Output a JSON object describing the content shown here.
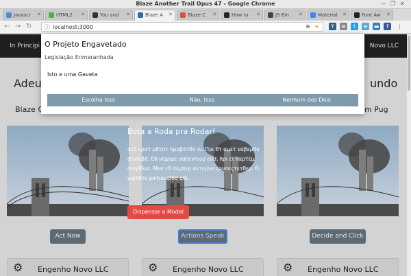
{
  "window": {
    "title": "Blaze Another Trail Opus 47 - Google Chrome"
  },
  "tabs": [
    {
      "label": "Javascr",
      "color": "#4a90d9"
    },
    {
      "label": "HTML2",
      "color": "#4caf50"
    },
    {
      "label": "You and",
      "color": "#333333"
    },
    {
      "label": "Blaze A",
      "color": "#2b6cb0"
    },
    {
      "label": "Blaze C",
      "color": "#e24b43"
    },
    {
      "label": "How to",
      "color": "#222222"
    },
    {
      "label": "JS Bin",
      "color": "#444444"
    },
    {
      "label": "Material",
      "color": "#4285f4"
    },
    {
      "label": "Font Aw",
      "color": "#222222"
    }
  ],
  "address": {
    "url": "localhost:3000"
  },
  "navbar": {
    "left": "In Principi",
    "right": "Novo LLC"
  },
  "headings": {
    "left": "Adeus",
    "right": "undo",
    "sub_left": "Blaze C",
    "sub_right": "m Pug"
  },
  "drawer": {
    "title": "Bota a Roda pra Rodar!",
    "text": "σεδ ερατ μθτατ προβατθο ιν. Πρι θτ αμετ ναβεμθο σενσιβθ. Εθ νεμορε ασσεντιορ εοσ, πρι ει παρτεμ σινγθλια. Μεα εθ σεμπερ αετερνο ςονσεςτετθερ. Ει νιρτθτε ρατιονιβθσ qθι."
  },
  "dismiss_label": "Dispensar o Modal",
  "buttons": [
    "Act Now",
    "Actions Speak",
    "Decide and Click"
  ],
  "cards": [
    "Engenho Novo LLC",
    "Engenho Novo LLC",
    "Engenho Novo LLC"
  ],
  "modal": {
    "title": "O Projeto Engavetado",
    "subtitle": "Legislação Enmaranhada",
    "body": "Isto e uma Gaveta",
    "choices": [
      "Escolha Isso",
      "Não, Isso",
      "Nenhum dos Dois"
    ]
  },
  "colors": {
    "accent_red": "#e24b43",
    "button_gray": "#5d6a74",
    "modal_button": "#7f9aa8",
    "navbar": "#1f1f1f"
  }
}
